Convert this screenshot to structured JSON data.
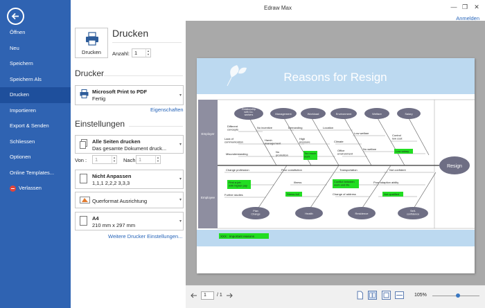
{
  "app": {
    "title": "Edraw Max",
    "signin": "Anmelden"
  },
  "window": {
    "minimize": "—",
    "restore": "❐",
    "close": "✕"
  },
  "sidebar": {
    "items": [
      {
        "label": "Öffnen"
      },
      {
        "label": "Neu"
      },
      {
        "label": "Speichern"
      },
      {
        "label": "Speichern Als"
      },
      {
        "label": "Drucken",
        "active": true
      },
      {
        "label": "Importieren"
      },
      {
        "label": "Export & Senden"
      },
      {
        "label": "Schliessen"
      },
      {
        "label": "Optionen"
      },
      {
        "label": "Online Templates..."
      },
      {
        "label": "Verlassen"
      }
    ]
  },
  "print": {
    "button_label": "Drucken",
    "heading": "Drucken",
    "copies_label": "Anzahl:",
    "copies_value": "1"
  },
  "printer": {
    "section": "Drucker",
    "name": "Microsoft Print to PDF",
    "status": "Fertig",
    "properties_link": "Eigenschaften"
  },
  "settings": {
    "section": "Einstellungen",
    "pages_title": "Alle Seiten drucken",
    "pages_sub": "Das gesamte Dokument druck...",
    "from_label": "Von :",
    "from_value": "1",
    "to_label": "Nach",
    "to_value": "1",
    "fit_title": "Nicht Anpassen",
    "fit_sub": "1,1,1  2,2,2  3,3,3",
    "orientation": "Querformat Ausrichtung",
    "paper_title": "A4",
    "paper_sub": "210 mm x 297 mm",
    "more_link": "Weitere Drucker Einstellungen..."
  },
  "diagram": {
    "title": "Reasons for Resign",
    "head": "Resign",
    "row_employer": "Employer",
    "row_employee": "Employee",
    "top_categories": [
      "Relationship with Co-workers",
      "Management",
      "Workload",
      "Environment",
      "Welfare",
      "Salary"
    ],
    "bottom_categories": [
      "Plan Change",
      "Health",
      "Residence",
      "Self-confidence"
    ],
    "causes_top": [
      "Different concepts",
      "Lack of communication",
      "Misunderstanding",
      "No incentive",
      "Harsh management",
      "No promotion",
      "Demanding",
      "High pressure",
      "Too much work",
      "Location",
      "Climate",
      "Office environment",
      "Low welfare",
      "No welfare",
      "Control low cost",
      "Low salary"
    ],
    "causes_bottom": [
      "Change profession",
      "Find a job with higher pay",
      "Further studies",
      "Poor constitution",
      "Illness",
      "Stress full",
      "Transportation",
      "Conflict between work and life",
      "Change of address",
      "Not confident",
      "Poor adaption ability",
      "Not qualified"
    ],
    "legend": "XXX : Important reasons"
  },
  "statusbar": {
    "page_value": "1",
    "page_total": "/ 1",
    "zoom": "105%",
    "zoom_level": 0.55
  },
  "colors": {
    "sidebar": "#2f63b2",
    "sidebar_active": "#1e4f9c",
    "banner": "#bcd9f0",
    "category_fill": "#6e6e84",
    "highlight": "#22dd22",
    "row_header": "#8e8ea0"
  }
}
